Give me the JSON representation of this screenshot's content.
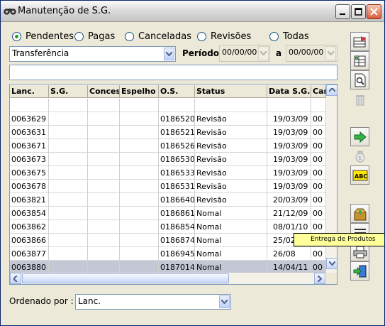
{
  "window": {
    "title": "Manutenção de S.G."
  },
  "filters": [
    {
      "label": "Pendentes",
      "selected": true
    },
    {
      "label": "Pagas",
      "selected": false
    },
    {
      "label": "Canceladas",
      "selected": false
    },
    {
      "label": "Revisões",
      "selected": false
    },
    {
      "label": "Todas",
      "selected": false
    }
  ],
  "type_combo": {
    "value": "Transferência"
  },
  "periodo": {
    "label": "Período:",
    "from": "00/00/00",
    "sep": "a",
    "to": "00/00/00"
  },
  "search": {
    "value": ""
  },
  "table": {
    "headers": [
      "Lanc.",
      "S.G.",
      "Conces.",
      "Espelho",
      "O.S.",
      "Status",
      "Data S.G.",
      "Can"
    ],
    "rows": [
      [
        "",
        "",
        "",
        "",
        "",
        "",
        "",
        ""
      ],
      [
        "0063629",
        "",
        "",
        "",
        "0186520",
        "Revisão",
        "19/03/09",
        "00"
      ],
      [
        "0063631",
        "",
        "",
        "",
        "0186521",
        "Revisão",
        "19/03/09",
        "00"
      ],
      [
        "0063671",
        "",
        "",
        "",
        "0186526",
        "Revisão",
        "19/03/09",
        "00"
      ],
      [
        "0063673",
        "",
        "",
        "",
        "0186530",
        "Revisão",
        "19/03/09",
        "00"
      ],
      [
        "0063675",
        "",
        "",
        "",
        "0186533",
        "Revisão",
        "19/03/09",
        "00"
      ],
      [
        "0063678",
        "",
        "",
        "",
        "0186531",
        "Revisão",
        "19/03/09",
        "00"
      ],
      [
        "0063821",
        "",
        "",
        "",
        "0186640",
        "Revisão",
        "20/03/09",
        "00"
      ],
      [
        "0063854",
        "",
        "",
        "",
        "0186861",
        "Nomal",
        "21/12/09",
        "00"
      ],
      [
        "0063862",
        "",
        "",
        "",
        "0186854",
        "Nomal",
        "08/01/10",
        "00"
      ],
      [
        "0063866",
        "",
        "",
        "",
        "0186874",
        "Nomal",
        "25/02/10",
        "00"
      ],
      [
        "0063877",
        "",
        "",
        "",
        "0186945",
        "Nomal",
        "26/08",
        "00"
      ],
      [
        "0063880",
        "",
        "",
        "",
        "0187014",
        "Nomal",
        "14/04/11",
        "00"
      ]
    ]
  },
  "order": {
    "label": "Ordenado por :",
    "value": "Lanc."
  },
  "tooltip": {
    "text": "Entrega de Produtos"
  },
  "toolbar": [
    {
      "icon": "insert-row-icon",
      "enabled": true
    },
    {
      "icon": "edit-grid-icon",
      "enabled": true
    },
    {
      "icon": "print-preview-icon",
      "enabled": true
    },
    {
      "icon": "trash-icon",
      "enabled": false
    },
    {
      "icon": "green-arrow-icon",
      "enabled": true
    },
    {
      "icon": "money-bag-icon",
      "enabled": false
    },
    {
      "icon": "abc-icon",
      "enabled": true
    },
    {
      "icon": "delivery-box-icon",
      "enabled": true
    },
    {
      "icon": "list-icon",
      "enabled": true
    },
    {
      "icon": "printer-icon",
      "enabled": true
    },
    {
      "icon": "exit-door-icon",
      "enabled": true
    }
  ],
  "colors": {
    "accent": "#0a246a",
    "selected_row": "#c4c8d4",
    "tooltip_bg": "#ffff99"
  }
}
